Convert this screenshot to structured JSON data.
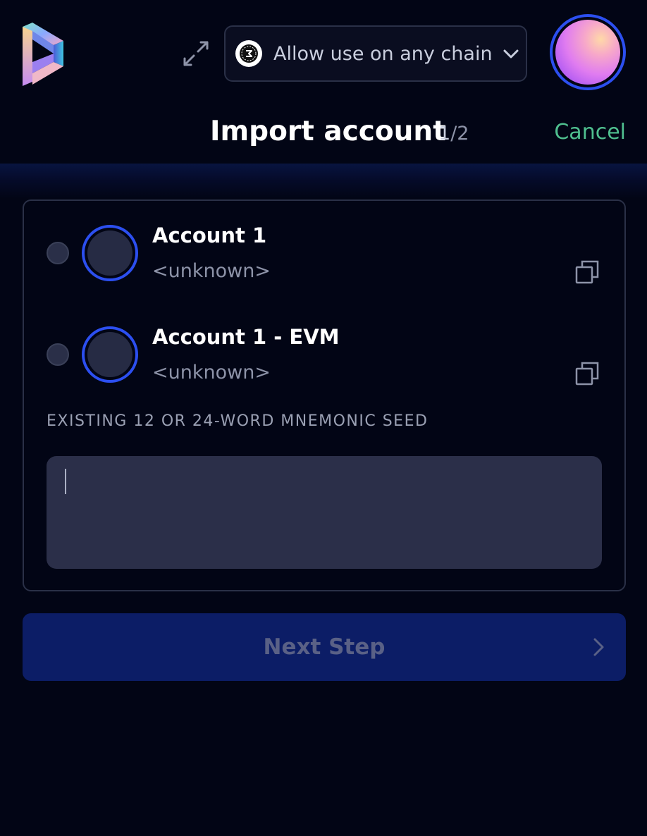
{
  "header": {
    "chain_selector": {
      "label": "Allow use on any chain"
    },
    "title": "Import account",
    "step": {
      "current": "1",
      "total": "/2"
    },
    "cancel_label": "Cancel"
  },
  "accounts": [
    {
      "name": "Account 1",
      "address": "<unknown>"
    },
    {
      "name": "Account 1 - EVM",
      "address": "<unknown>"
    }
  ],
  "seed": {
    "label": "EXISTING 12 OR 24-WORD MNEMONIC SEED",
    "value": ""
  },
  "next_button": {
    "label": "Next Step"
  },
  "colors": {
    "background": "#020515",
    "accent_blue": "#2c4ff0",
    "cancel_green": "#4fbf8f",
    "button_disabled": "#0c1d66",
    "input_bg": "#2b2f49"
  },
  "icons": {
    "logo": "logo-icon",
    "expand": "expand-icon",
    "chain": "chain-icon",
    "chevron_down": "chevron-down-icon",
    "copy": "copy-icon",
    "chevron_right": "chevron-right-icon"
  }
}
